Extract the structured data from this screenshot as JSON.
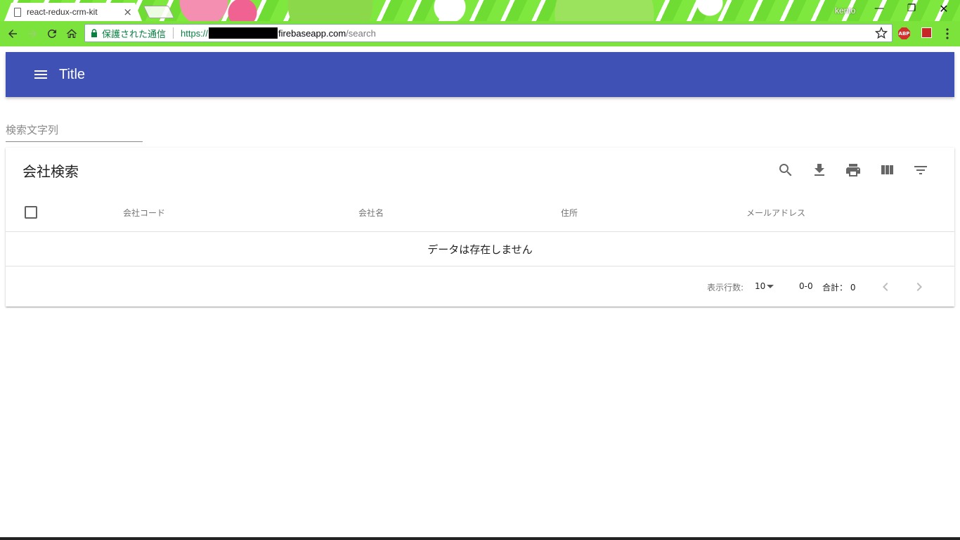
{
  "browser": {
    "tab_title": "react-redux-crm-kit",
    "tab_close": "×",
    "profile_name": "kento",
    "secure_label": "保護された通信",
    "url_scheme": "https://",
    "url_host": "firebaseapp.com",
    "url_path": "/search",
    "extension_abp": "ABP",
    "window_controls": {
      "minimize": "—",
      "maximize": "❐",
      "close": "✕"
    },
    "accent_colors": {
      "toolbar": "#7ce23c",
      "secure_text": "#0b8043"
    }
  },
  "app_bar": {
    "title": "Title",
    "color": "#3f51b5"
  },
  "search": {
    "placeholder": "検索文字列",
    "value": ""
  },
  "table": {
    "title": "会社検索",
    "toolbar_icons": [
      "search-icon",
      "download-icon",
      "print-icon",
      "view-columns-icon",
      "filter-icon"
    ],
    "columns": [
      "会社コード",
      "会社名",
      "住所",
      "メールアドレス"
    ],
    "empty_message": "データは存在しません",
    "footer": {
      "rows_per_page_label": "表示行数:",
      "rows_per_page_value": "10",
      "range": "0-0",
      "total": "合計： 0"
    }
  }
}
